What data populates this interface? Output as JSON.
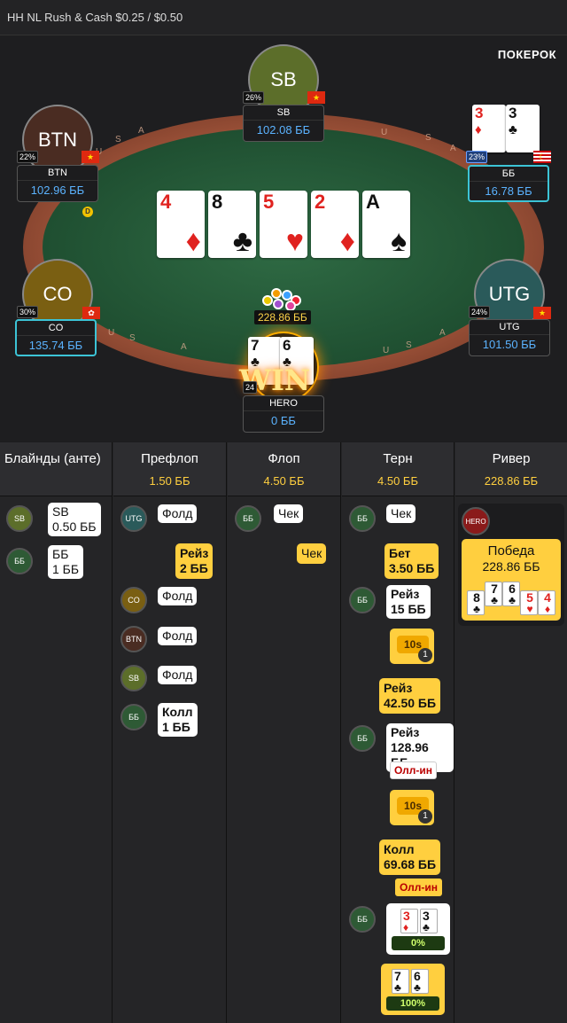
{
  "title": "HH NL Rush & Cash $0.25 / $0.50",
  "logo": "ПОКЕРОК",
  "rail_letters": [
    "U",
    "S",
    "A",
    "U",
    "S",
    "A",
    "U",
    "S",
    "A",
    "U",
    "S",
    "A"
  ],
  "board": [
    {
      "rank": "4",
      "suit": "♦",
      "color": "red"
    },
    {
      "rank": "8",
      "suit": "♣",
      "color": "black"
    },
    {
      "rank": "5",
      "suit": "♥",
      "color": "red"
    },
    {
      "rank": "2",
      "suit": "♦",
      "color": "red"
    },
    {
      "rank": "A",
      "suit": "♠",
      "color": "black"
    }
  ],
  "pot": "228.86 ББ",
  "win_text": "WIN",
  "dealer_label": "D",
  "seats": {
    "sb": {
      "avatar": "SB",
      "pct": "26%",
      "flag": "★",
      "name": "SB",
      "stack": "102.08 ББ"
    },
    "btn": {
      "avatar": "BTN",
      "pct": "22%",
      "flag": "★",
      "name": "BTN",
      "stack": "102.96 ББ"
    },
    "bb": {
      "pct": "23%",
      "flag": "☾",
      "name": "ББ",
      "stack": "16.78 ББ",
      "cards": [
        {
          "rank": "3",
          "suit": "♦",
          "color": "red"
        },
        {
          "rank": "3",
          "suit": "♣",
          "color": "black"
        }
      ]
    },
    "co": {
      "avatar": "CO",
      "pct": "30%",
      "flag": "✿",
      "name": "CO",
      "stack": "135.74 ББ"
    },
    "utg": {
      "avatar": "UTG",
      "pct": "24%",
      "flag": "★",
      "name": "UTG",
      "stack": "101.50 ББ"
    },
    "hero": {
      "pct": "24",
      "name": "HERO",
      "stack": "0 ББ",
      "cards": [
        {
          "rank": "7",
          "suit": "♣",
          "color": "black"
        },
        {
          "rank": "6",
          "suit": "♣",
          "color": "black"
        }
      ]
    }
  },
  "history": {
    "columns": [
      {
        "title": "Блайнды (анте)",
        "pot": ""
      },
      {
        "title": "Префлоп",
        "pot": "1.50 ББ"
      },
      {
        "title": "Флоп",
        "pot": "4.50 ББ"
      },
      {
        "title": "Терн",
        "pot": "4.50 ББ"
      },
      {
        "title": "Ривер",
        "pot": "228.86 ББ"
      }
    ],
    "blinds": {
      "sb_badge": "SB",
      "sb_text1": "SB",
      "sb_text2": "0.50 ББ",
      "bb_badge": "ББ",
      "bb_text1": "ББ",
      "bb_text2": "1 ББ"
    },
    "preflop": {
      "utg_badge": "UTG",
      "utg_action": "Фолд",
      "hero_raise1": "Рейз",
      "hero_raise2": "2 ББ",
      "co_badge": "CO",
      "co_action": "Фолд",
      "btn_badge": "BTN",
      "btn_action": "Фолд",
      "sb_badge": "SB",
      "sb_action": "Фолд",
      "bb_badge": "ББ",
      "bb_call1": "Колл",
      "bb_call2": "1 ББ"
    },
    "flop": {
      "bb_badge": "ББ",
      "bb_action": "Чек",
      "hero_action": "Чек"
    },
    "turn": {
      "bb_badge1": "ББ",
      "bb_check": "Чек",
      "hero_bet1": "Бет",
      "hero_bet2": "3.50 ББ",
      "bb_badge2": "ББ",
      "bb_raise1": "Рейз",
      "bb_raise2": "15 ББ",
      "sess1": "10s",
      "sess1_count": "1",
      "hero_raise1": "Рейз",
      "hero_raise2": "42.50 ББ",
      "bb_badge3": "ББ",
      "bb_raise3": "Рейз",
      "bb_raise4": "128.96 ББ",
      "bb_allin": "Олл-ин",
      "sess2": "10s",
      "sess2_count": "1",
      "hero_call1": "Колл",
      "hero_call2": "69.68 ББ",
      "hero_allin": "Олл-ин",
      "bb_badge4": "ББ",
      "bb_cards": [
        {
          "rank": "3",
          "suit": "♦",
          "color": "red"
        },
        {
          "rank": "3",
          "suit": "♣",
          "color": "black"
        }
      ],
      "bb_equity": "0%",
      "hero_cards": [
        {
          "rank": "7",
          "suit": "♣",
          "color": "black"
        },
        {
          "rank": "6",
          "suit": "♣",
          "color": "black"
        }
      ],
      "hero_equity": "100%"
    },
    "river": {
      "hero_badge": "HERO",
      "win_label": "Победа",
      "win_amount": "228.86 ББ",
      "cards": [
        {
          "rank": "8",
          "suit": "♣",
          "color": "black"
        },
        {
          "rank": "7",
          "suit": "♣",
          "color": "black"
        },
        {
          "rank": "6",
          "suit": "♣",
          "color": "black"
        },
        {
          "rank": "5",
          "suit": "♥",
          "color": "red"
        },
        {
          "rank": "4",
          "suit": "♦",
          "color": "red"
        }
      ]
    }
  }
}
